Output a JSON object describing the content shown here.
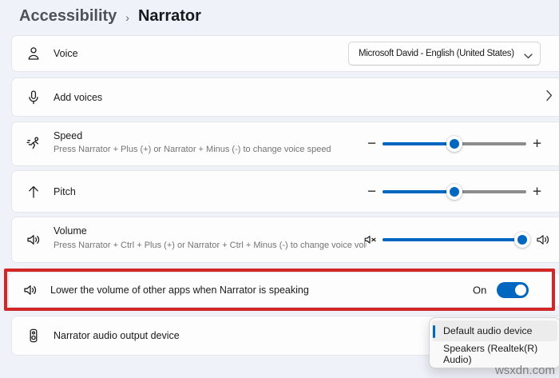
{
  "breadcrumb": {
    "parent": "Accessibility",
    "separator": "›",
    "current": "Narrator"
  },
  "rows": {
    "voice": {
      "label": "Voice",
      "dropdown_value": "Microsoft David - English (United States)"
    },
    "add_voices": {
      "label": "Add voices"
    },
    "speed": {
      "label": "Speed",
      "description": "Press Narrator + Plus (+) or Narrator + Minus (-) to change voice speed",
      "slider_percent": 50,
      "minus_label": "−",
      "plus_label": "+"
    },
    "pitch": {
      "label": "Pitch",
      "slider_percent": 50,
      "minus_label": "−",
      "plus_label": "+"
    },
    "volume": {
      "label": "Volume",
      "description": "Press Narrator + Ctrl + Plus (+) or Narrator + Ctrl + Minus (-) to change voice volu",
      "slider_percent": 97
    },
    "lower_volume": {
      "label": "Lower the volume of other apps when Narrator is speaking",
      "toggle_state": "On"
    },
    "audio_output": {
      "label": "Narrator audio output device"
    }
  },
  "audio_device_menu": {
    "items": [
      {
        "label": "Default audio device",
        "selected": true
      },
      {
        "label": "Speakers (Realtek(R) Audio)",
        "selected": false
      }
    ]
  },
  "watermark": "wsxdn.com",
  "icons": {
    "voice": "person-icon",
    "add_voices": "microphone-icon",
    "speed": "running-person-icon",
    "pitch": "arrow-up-icon",
    "volume": "speaker-icon",
    "volume_min": "speaker-mute-icon",
    "volume_max": "speaker-icon",
    "lower_volume": "speaker-icon",
    "audio_output": "speaker-box-icon",
    "voice_dropdown": "chevron-down-icon",
    "add_voices_nav": "chevron-right-icon"
  },
  "colors": {
    "accent": "#0067c0",
    "annotation_red": "#d32626",
    "slider_track": "#8c8c8c",
    "page_background": "#eff3f9",
    "row_background": "#fdfdfe"
  }
}
